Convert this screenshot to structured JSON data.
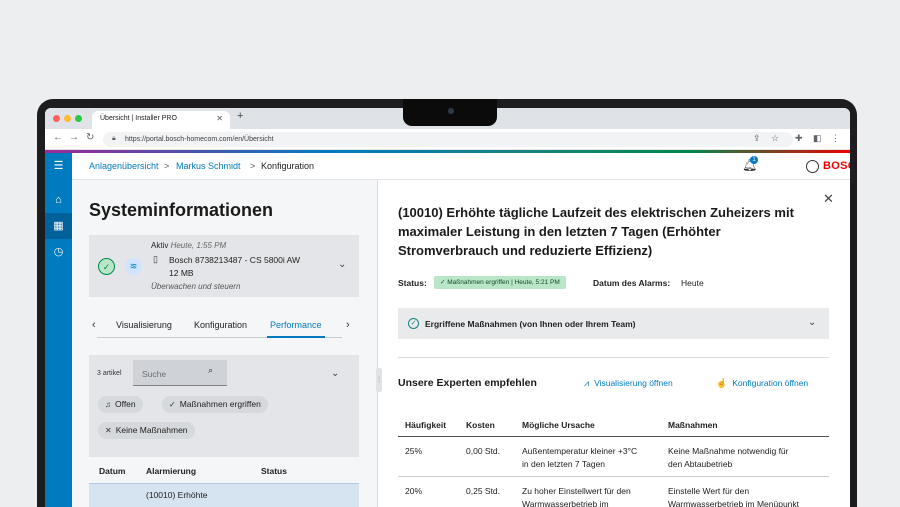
{
  "browser": {
    "tab_title": "Übersicht | Installer PRO",
    "url": "https://portal.bosch-homecom.com/en/Übersicht"
  },
  "brand": {
    "logo": "BOSCH",
    "accent": "#007bc0",
    "brand_red": "#e00000"
  },
  "breadcrumb": {
    "items": [
      "Anlagenübersicht",
      "Markus Schmidt",
      "Konfiguration"
    ],
    "separator": ">"
  },
  "notifications": {
    "count": "1"
  },
  "system": {
    "title": "Systeminformationen",
    "device": {
      "status_label": "Aktiv",
      "status_time": "Heute, 1:55 PM",
      "name": "Bosch 8738213487 - CS 5800i AW",
      "size": "12 MB",
      "subtitle": "Überwachen und steuern"
    },
    "tabs": [
      "Visualisierung",
      "Konfiguration",
      "Performance"
    ],
    "active_tab": "Performance"
  },
  "filters": {
    "count": "3 artikel",
    "search_placeholder": "Suche",
    "chips": [
      "Offen",
      "Maßnahmen ergriffen",
      "Keine Maßnahmen"
    ]
  },
  "alarm_table": {
    "headers": [
      "Datum",
      "Alarmierung",
      "Status"
    ],
    "rows": [
      {
        "alarm": "(10010) Erhöhte"
      }
    ]
  },
  "alarm": {
    "title": "(10010) Erhöhte tägliche Laufzeit des elektrischen Zuheizers mit maximaler Leistung in den letzten 7 Tagen (Erhöhter Stromverbrauch und reduzierte Effizienz)",
    "status_label": "Status:",
    "status_badge": "Maßnahmen ergriffen | Heute, 5:21 PM",
    "date_label": "Datum des Alarms:",
    "date_value": "Heute",
    "actions_label": "Ergriffene Maßnahmen (von Ihnen oder Ihrem Team)",
    "experts_title": "Unsere Experten empfehlen",
    "link_visualisierung": "Visualisierung öffnen",
    "link_konfiguration": "Konfiguration öffnen",
    "table": {
      "headers": [
        "Häufigkeit",
        "Kosten",
        "Mögliche Ursache",
        "Maßnahmen"
      ],
      "rows": [
        {
          "haeufigkeit": "25%",
          "kosten": "0,00 Std.",
          "ursache_1": "Außentemperatur kleiner +3°C",
          "ursache_2": "in den letzten 7 Tagen",
          "massnahme_1": "Keine Maßnahme notwendig für",
          "massnahme_2": "den Abtaubetrieb"
        },
        {
          "haeufigkeit": "20%",
          "kosten": "0,25 Std.",
          "ursache_1": "Zu hoher Einstellwert für den",
          "ursache_2": "Warmwasserbetrieb im",
          "massnahme_1": "Einstelle Wert für den",
          "massnahme_2": "Warmwasserbetrieb im Menüpunkt"
        }
      ]
    }
  }
}
